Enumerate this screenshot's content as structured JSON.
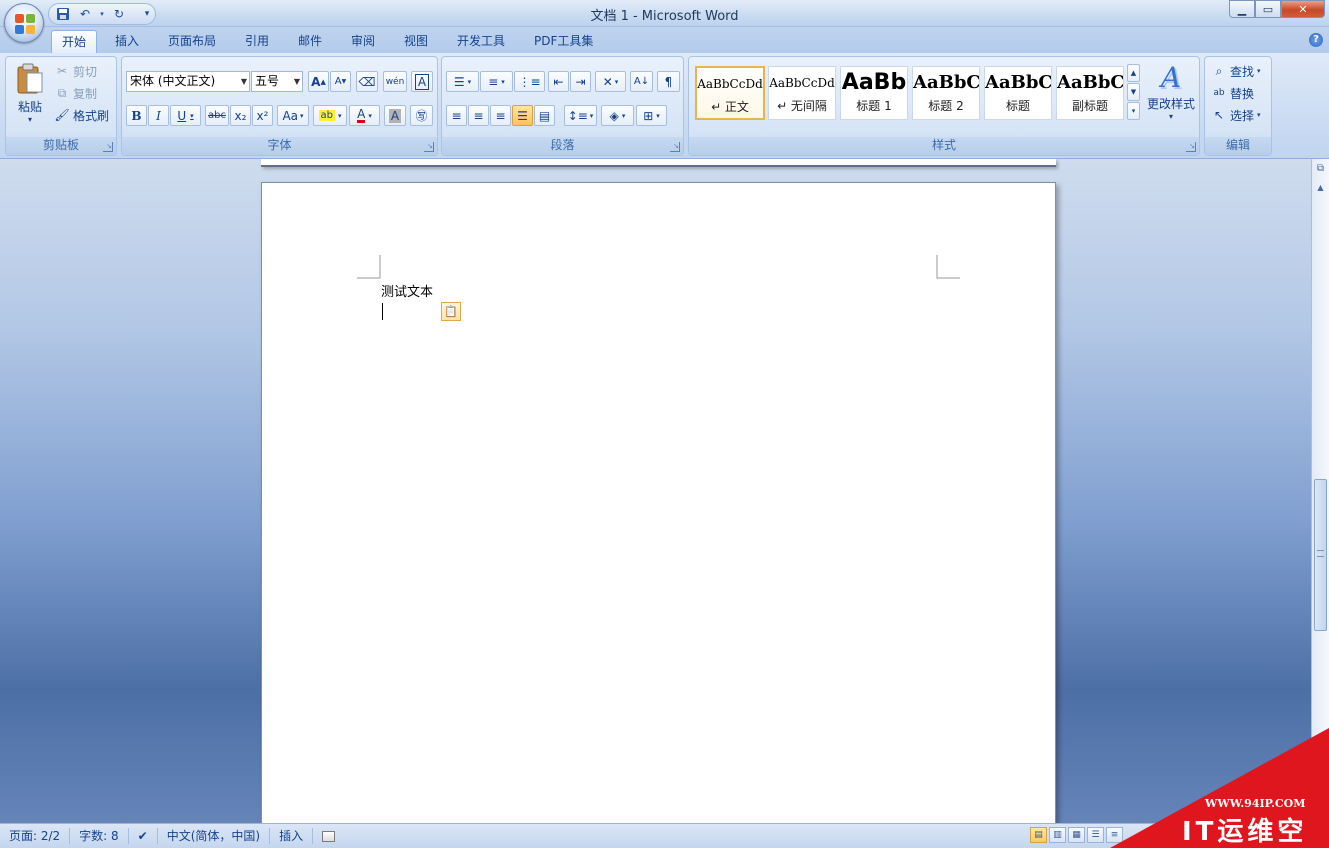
{
  "window": {
    "title": "文档 1 - Microsoft Word",
    "minimize_icon": "minimize-icon",
    "maximize_icon": "maximize-icon",
    "close_icon": "close-icon"
  },
  "qat": {
    "save_icon": "save-icon",
    "undo_icon": "undo-icon",
    "redo_icon": "redo-icon",
    "customize_icon": "customize-icon"
  },
  "tabs": [
    "开始",
    "插入",
    "页面布局",
    "引用",
    "邮件",
    "审阅",
    "视图",
    "开发工具",
    "PDF工具集"
  ],
  "ribbon": {
    "clipboard": {
      "label": "剪贴板",
      "paste": "粘贴",
      "cut": "剪切",
      "copy": "复制",
      "format_painter": "格式刷"
    },
    "font": {
      "label": "字体",
      "font_name": "宋体 (中文正文)",
      "font_size": "五号",
      "bold": "B",
      "italic": "I",
      "underline": "U",
      "strike": "abc",
      "subscript": "x₂",
      "superscript": "x²",
      "change_case": "Aa",
      "grow": "A",
      "shrink": "A",
      "text_effect": "A",
      "char_shading": "A",
      "wen": "wén",
      "char_border": "A"
    },
    "paragraph": {
      "label": "段落"
    },
    "styles": {
      "label": "样式",
      "items": [
        {
          "sample": "AaBbCcDd",
          "name": "↵ 正文"
        },
        {
          "sample": "AaBbCcDd",
          "name": "↵ 无间隔"
        },
        {
          "sample": "AaBb",
          "name": "标题 1"
        },
        {
          "sample": "AaBbC",
          "name": "标题 2"
        },
        {
          "sample": "AaBbC",
          "name": "标题"
        },
        {
          "sample": "AaBbC",
          "name": "副标题"
        }
      ],
      "change_styles": "更改样式"
    },
    "editing": {
      "label": "编辑",
      "find": "查找",
      "replace": "替换",
      "select": "选择"
    }
  },
  "document": {
    "text": "测试文本"
  },
  "statusbar": {
    "page": "页面: 2/2",
    "words": "字数: 8",
    "language": "中文(简体，中国)",
    "mode": "插入"
  },
  "watermark": {
    "url": "WWW.94IP.COM",
    "text": "IT运维空间"
  }
}
